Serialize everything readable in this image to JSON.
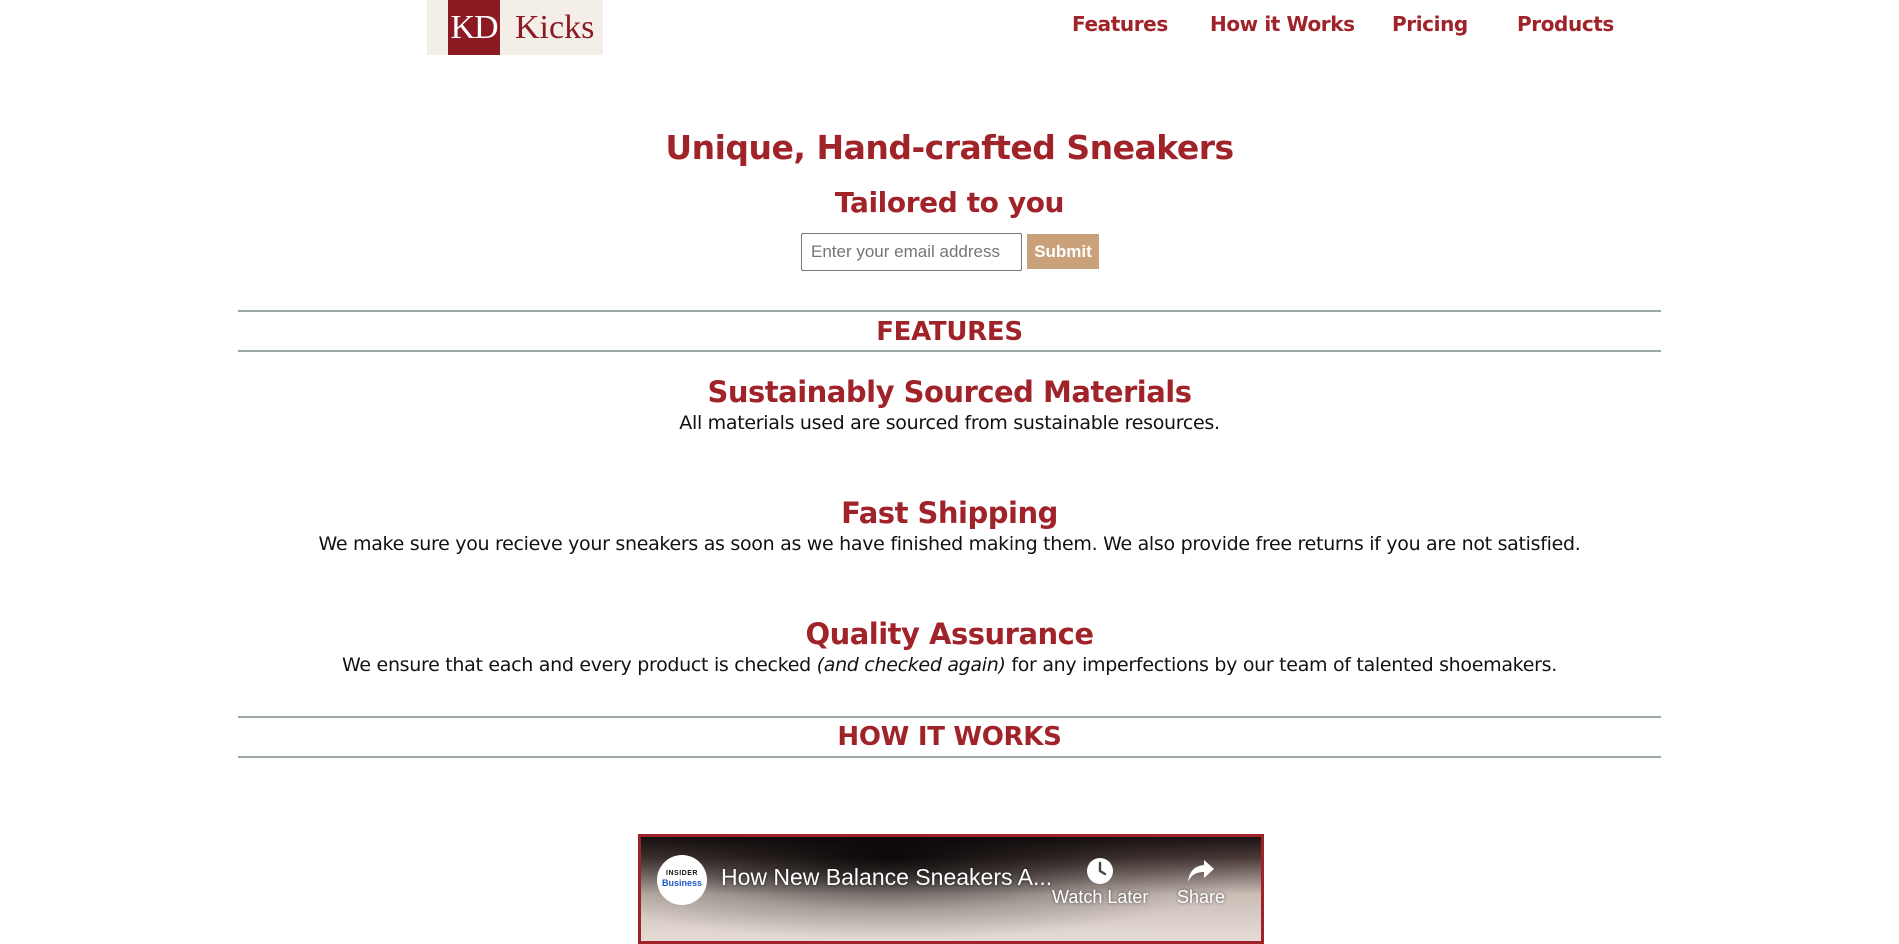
{
  "logo": {
    "kd": "KD",
    "name": "Kicks"
  },
  "nav": {
    "links": [
      {
        "label": "Features"
      },
      {
        "label": "How it Works"
      },
      {
        "label": "Pricing"
      },
      {
        "label": "Products"
      }
    ]
  },
  "hero": {
    "title": "Unique, Hand-crafted Sneakers",
    "subtitle": "Tailored to you",
    "email_placeholder": "Enter your email address",
    "submit_label": "Submit"
  },
  "features": {
    "heading": "FEATURES",
    "items": [
      {
        "title": "Sustainably Sourced Materials",
        "desc": "All materials used are sourced from sustainable resources."
      },
      {
        "title": "Fast Shipping",
        "desc": "We make sure you recieve your sneakers as soon as we have finished making them. We also provide free returns if you are not satisfied."
      },
      {
        "title": "Quality Assurance",
        "desc_before": "We ensure that each and every product is checked ",
        "desc_emphasis": "(and checked again)",
        "desc_after": " for any imperfections by our team of talented shoemakers."
      }
    ]
  },
  "how_it_works": {
    "heading": "HOW IT WORKS",
    "video": {
      "channel_top": "INSIDER",
      "channel_bottom": "Business",
      "title": "How New Balance Sneakers A...",
      "watch_later": "Watch Later",
      "share": "Share"
    }
  },
  "colors": {
    "accent": "#a0232a",
    "logo_bg": "#f4eee8",
    "button": "#c9a27c",
    "rule": "#9aa6a8"
  }
}
